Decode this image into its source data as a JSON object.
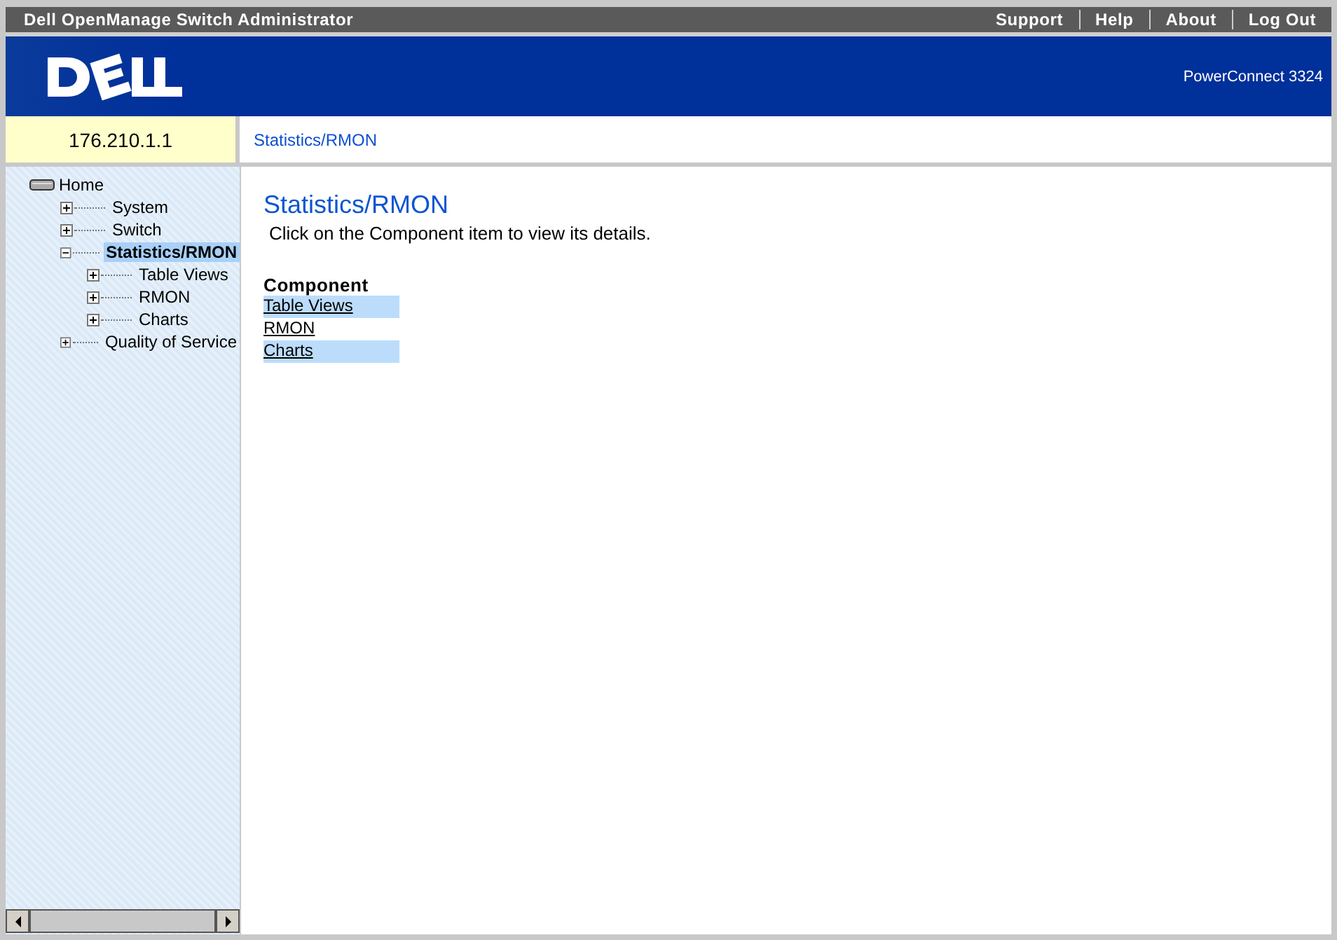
{
  "window": {
    "title": "Dell OpenManage Switch Administrator"
  },
  "top_links": [
    "Support",
    "Help",
    "About",
    "Log Out"
  ],
  "banner": {
    "model": "PowerConnect 3324"
  },
  "device_ip": "176.210.1.1",
  "breadcrumb": "Statistics/RMON",
  "tree": {
    "label": "Home",
    "children": [
      {
        "label": "System",
        "expanded": false,
        "selected": false
      },
      {
        "label": "Switch",
        "expanded": false,
        "selected": false
      },
      {
        "label": "Statistics/RMON",
        "expanded": true,
        "selected": true,
        "children": [
          {
            "label": "Table Views",
            "expanded": false,
            "selected": false
          },
          {
            "label": "RMON",
            "expanded": false,
            "selected": false
          },
          {
            "label": "Charts",
            "expanded": false,
            "selected": false
          }
        ]
      },
      {
        "label": "Quality of Service",
        "expanded": false,
        "selected": false
      }
    ]
  },
  "content": {
    "heading": "Statistics/RMON",
    "instruction": "Click on the Component item to view its details.",
    "table_heading": "Component",
    "components": [
      "Table Views",
      "RMON",
      "Charts"
    ]
  }
}
